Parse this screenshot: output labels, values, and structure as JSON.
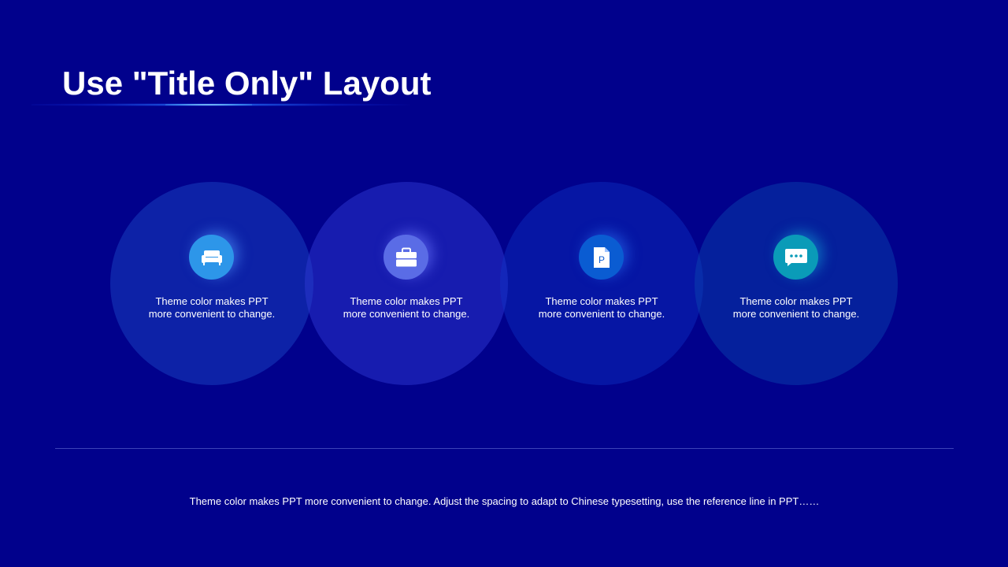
{
  "slide": {
    "title": "Use \"Title Only\" Layout",
    "background_color": "#01018c",
    "items": [
      {
        "icon": "sofa-icon",
        "color": "#2d96e9",
        "line1": "Theme color makes PPT",
        "line2": "more convenient  to change."
      },
      {
        "icon": "briefcase-icon",
        "color": "#5a6ce6",
        "line1": "Theme color makes PPT",
        "line2": "more convenient  to change."
      },
      {
        "icon": "ppt-file-icon",
        "color": "#0a5cd2",
        "line1": "Theme color makes PPT",
        "line2": "more convenient  to change."
      },
      {
        "icon": "chat-bubble-icon",
        "color": "#0a9bb8",
        "line1": "Theme color makes PPT",
        "line2": "more convenient  to change."
      }
    ],
    "footer": "Theme  color makes PPT more convenient  to change. Adjust the spacing to adapt to Chinese  typesetting, use the reference line in PPT……"
  }
}
